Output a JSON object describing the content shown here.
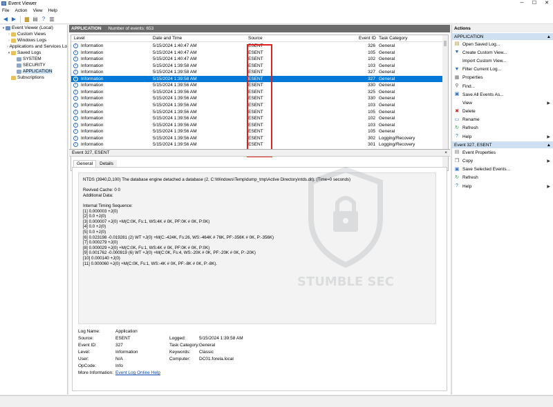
{
  "window": {
    "title": "Event Viewer"
  },
  "menu": [
    "File",
    "Action",
    "View",
    "Help"
  ],
  "tree": [
    {
      "label": "Event Viewer (Local)",
      "level": 0,
      "twisty": "▾",
      "icon": "computer-icon",
      "color": "#6a8fbf"
    },
    {
      "label": "Custom Views",
      "level": 1,
      "twisty": "›",
      "icon": "folder-icon",
      "color": "#e8c15a"
    },
    {
      "label": "Windows Logs",
      "level": 1,
      "twisty": "›",
      "icon": "folder-icon",
      "color": "#e8c15a"
    },
    {
      "label": "Applications and Services Lo",
      "level": 1,
      "twisty": "›",
      "icon": "folder-icon",
      "color": "#e8c15a"
    },
    {
      "label": "Saved Logs",
      "level": 1,
      "twisty": "▾",
      "icon": "folder-icon",
      "color": "#e8c15a"
    },
    {
      "label": "SYSTEM",
      "level": 2,
      "twisty": "",
      "icon": "log-icon",
      "color": "#8fa8c8"
    },
    {
      "label": "SECURITY",
      "level": 2,
      "twisty": "",
      "icon": "log-icon",
      "color": "#8fa8c8"
    },
    {
      "label": "APPLICATION",
      "level": 2,
      "twisty": "",
      "icon": "log-icon",
      "color": "#8fa8c8",
      "selected": true
    },
    {
      "label": "Subscriptions",
      "level": 1,
      "twisty": "",
      "icon": "subscriptions-icon",
      "color": "#e8c15a"
    }
  ],
  "list": {
    "title": "APPLICATION",
    "count": "Number of events: 653",
    "columns": {
      "level": "Level",
      "date": "Date and Time",
      "source": "Source",
      "id": "Event ID",
      "category": "Task Category"
    },
    "rows": [
      {
        "level": "Information",
        "date": "5/15/2024 1:40:47 AM",
        "source": "ESENT",
        "id": "326",
        "category": "General"
      },
      {
        "level": "Information",
        "date": "5/15/2024 1:40:47 AM",
        "source": "ESENT",
        "id": "105",
        "category": "General"
      },
      {
        "level": "Information",
        "date": "5/15/2024 1:40:47 AM",
        "source": "ESENT",
        "id": "102",
        "category": "General"
      },
      {
        "level": "Information",
        "date": "5/15/2024 1:39:58 AM",
        "source": "ESENT",
        "id": "103",
        "category": "General"
      },
      {
        "level": "Information",
        "date": "5/15/2024 1:39:58 AM",
        "source": "ESENT",
        "id": "327",
        "category": "General"
      },
      {
        "level": "Information",
        "date": "5/15/2024 1:39:58 AM",
        "source": "ESENT",
        "id": "327",
        "category": "General",
        "selected": true
      },
      {
        "level": "Information",
        "date": "5/15/2024 1:39:56 AM",
        "source": "ESENT",
        "id": "330",
        "category": "General"
      },
      {
        "level": "Information",
        "date": "5/15/2024 1:39:56 AM",
        "source": "ESENT",
        "id": "325",
        "category": "General"
      },
      {
        "level": "Information",
        "date": "5/15/2024 1:39:56 AM",
        "source": "ESENT",
        "id": "330",
        "category": "General"
      },
      {
        "level": "Information",
        "date": "5/15/2024 1:39:56 AM",
        "source": "ESENT",
        "id": "103",
        "category": "General"
      },
      {
        "level": "Information",
        "date": "5/15/2024 1:39:56 AM",
        "source": "ESENT",
        "id": "105",
        "category": "General"
      },
      {
        "level": "Information",
        "date": "5/15/2024 1:39:56 AM",
        "source": "ESENT",
        "id": "102",
        "category": "General"
      },
      {
        "level": "Information",
        "date": "5/15/2024 1:39:56 AM",
        "source": "ESENT",
        "id": "103",
        "category": "General"
      },
      {
        "level": "Information",
        "date": "5/15/2024 1:39:56 AM",
        "source": "ESENT",
        "id": "105",
        "category": "General"
      },
      {
        "level": "Information",
        "date": "5/15/2024 1:39:56 AM",
        "source": "ESENT",
        "id": "302",
        "category": "Logging/Recovery"
      },
      {
        "level": "Information",
        "date": "5/15/2024 1:39:56 AM",
        "source": "ESENT",
        "id": "301",
        "category": "Logging/Recovery"
      }
    ]
  },
  "detail": {
    "header": "Event 327, ESENT",
    "close": "×",
    "tabs": [
      "General",
      "Details"
    ],
    "message": [
      "NTDS (3940,D,100) The database engine detached a database (2, C:\\Windows\\Temp\\dump_tmp\\Active Directory\\ntds.dit). (Time=0 seconds)",
      "",
      "Revived Cache: 0 0",
      "Additional Data:",
      "",
      "Internal Timing Sequence:",
      "[1] 0.000003 +J(0)",
      "[2] 0.0 +J(0)",
      "[3] 0.000007 +J(0) +M(C:0K, Fs:1, WS:4K # 0K, PF:0K # 0K, P:0K)",
      "[4] 0.0 +J(0)",
      "[5] 0.0 +J(0)",
      "[6] 0.023198 -0.019281 (2) WT +J(0) +M(C:-424K, Fs:26, WS:-464K # 76K, PF:-356K # 0K, P:-356K)",
      "[7] 0.000279 +J(0)",
      "[8] 0.000029 +J(0) +M(C:0K, Fs:1, WS:4K # 0K, PF:0K # 0K, P:0K)",
      "[9] 0.001762 -0.000919 (6) WT +J(0) +M(C:0K, Fs:4, WS:-20K # 0K, PF:-20K # 0K, P:-20K)",
      "[10] 0.000140 +J(0)",
      "[11] 0.000060 +J(0) +M(C:0K, Fs:1, WS:-4K # 0K, PF:-8K # 0K, P:-8K)."
    ],
    "props": {
      "log_name_label": "Log Name:",
      "log_name": "Application",
      "source_label": "Source:",
      "source": "ESENT",
      "logged_label": "Logged:",
      "logged": "5/15/2024 1:39:58 AM",
      "event_id_label": "Event ID:",
      "event_id": "327",
      "task_category_label": "Task Category:",
      "task_category": "General",
      "level_label": "Level:",
      "level": "Information",
      "keywords_label": "Keywords:",
      "keywords": "Classic",
      "user_label": "User:",
      "user": "N/A",
      "computer_label": "Computer:",
      "computer": "DC01.forela.local",
      "opcode_label": "OpCode:",
      "opcode": "Info",
      "more_info_label": "More Information:",
      "more_info": "Event Log Online Help"
    }
  },
  "actions": {
    "header": "Actions",
    "section1": "APPLICATION",
    "items1": [
      {
        "label": "Open Saved Log...",
        "icon": "open-log-icon",
        "glyph": "▤",
        "color": "#b08a2e"
      },
      {
        "label": "Create Custom View...",
        "icon": "filter-icon",
        "glyph": "▼",
        "color": "#2b6cc4"
      },
      {
        "label": "Import Custom View...",
        "icon": "import-icon",
        "glyph": "",
        "color": "#2b6cc4"
      },
      {
        "label": "Filter Current Log...",
        "icon": "filter-icon",
        "glyph": "▼",
        "color": "#2b6cc4"
      },
      {
        "label": "Properties",
        "icon": "properties-icon",
        "glyph": "▦",
        "color": "#6a6a6a"
      },
      {
        "label": "Find...",
        "icon": "find-icon",
        "glyph": "⚲",
        "color": "#555"
      },
      {
        "label": "Save All Events As...",
        "icon": "save-icon",
        "glyph": "▣",
        "color": "#2b6cc4"
      },
      {
        "label": "View",
        "icon": "view-icon",
        "glyph": "",
        "color": "#2b6cc4",
        "submenu": true
      },
      {
        "label": "Delete",
        "icon": "delete-icon",
        "glyph": "✖",
        "color": "#d42020"
      },
      {
        "label": "Rename",
        "icon": "rename-icon",
        "glyph": "▭",
        "color": "#2b6cc4"
      },
      {
        "label": "Refresh",
        "icon": "refresh-icon",
        "glyph": "↻",
        "color": "#2a9a3a"
      },
      {
        "label": "Help",
        "icon": "help-icon",
        "glyph": "?",
        "color": "#2b6cc4",
        "submenu": true
      }
    ],
    "section2": "Event 327, ESENT",
    "items2": [
      {
        "label": "Event Properties",
        "icon": "event-properties-icon",
        "glyph": "▤",
        "color": "#6a6a6a"
      },
      {
        "label": "Copy",
        "icon": "copy-icon",
        "glyph": "❐",
        "color": "#555",
        "submenu": true
      },
      {
        "label": "Save Selected Events...",
        "icon": "save-icon",
        "glyph": "▣",
        "color": "#2b6cc4"
      },
      {
        "label": "Refresh",
        "icon": "refresh-icon",
        "glyph": "↻",
        "color": "#2a9a3a"
      },
      {
        "label": "Help",
        "icon": "help-icon",
        "glyph": "?",
        "color": "#2b6cc4",
        "submenu": true
      }
    ]
  },
  "watermark": "STUMBLE SEC"
}
